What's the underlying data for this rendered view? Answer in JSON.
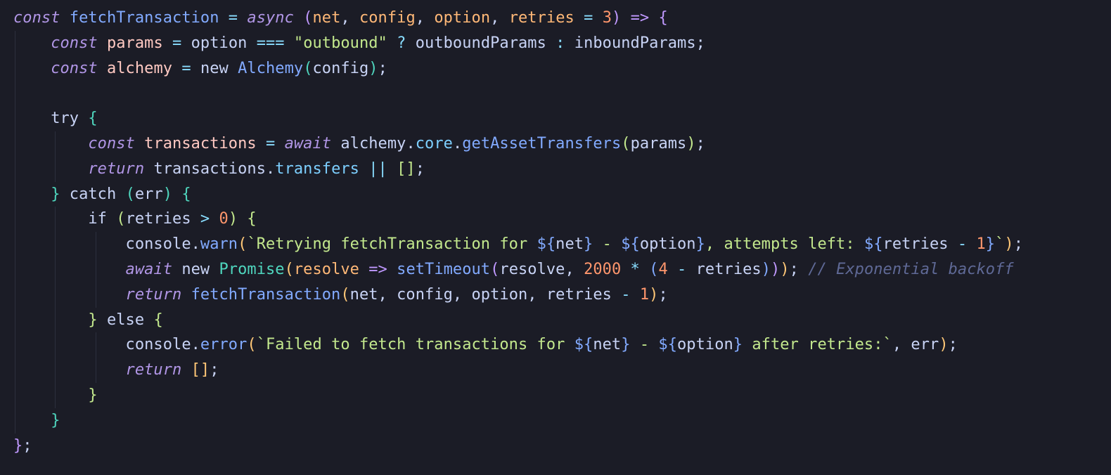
{
  "editor": {
    "language": "javascript",
    "background_color": "#1b1c26",
    "default_text_color": "#c8d3f5",
    "indent_guide_color": "#2c2f3d",
    "lines": [
      [
        {
          "t": "const",
          "c": "#b196e6",
          "i": true
        },
        {
          "t": " fetchTransaction",
          "c": "#82aaff"
        },
        {
          "t": " = ",
          "c": "#89ddff"
        },
        {
          "t": "async",
          "c": "#b196e6",
          "i": true
        },
        {
          "t": " (",
          "c": "#c099ff"
        },
        {
          "t": "net",
          "c": "#ffb877"
        },
        {
          "t": ", ",
          "c": "#c8d3f5"
        },
        {
          "t": "config",
          "c": "#ffb877"
        },
        {
          "t": ", ",
          "c": "#c8d3f5"
        },
        {
          "t": "option",
          "c": "#ffb877"
        },
        {
          "t": ", ",
          "c": "#c8d3f5"
        },
        {
          "t": "retries",
          "c": "#ffb877"
        },
        {
          "t": " = ",
          "c": "#89ddff"
        },
        {
          "t": "3",
          "c": "#ff966c"
        },
        {
          "t": ")",
          "c": "#c099ff"
        },
        {
          "t": " => ",
          "c": "#c099ff"
        },
        {
          "t": "{",
          "c": "#c099ff"
        }
      ],
      [
        {
          "t": "    ",
          "c": "#c8d3f5"
        },
        {
          "t": "const",
          "c": "#b196e6",
          "i": true
        },
        {
          "t": " params",
          "c": "#ffc9c2"
        },
        {
          "t": " = ",
          "c": "#89ddff"
        },
        {
          "t": "option",
          "c": "#c8d3f5"
        },
        {
          "t": " === ",
          "c": "#89ddff"
        },
        {
          "t": "\"outbound\"",
          "c": "#c3e88d"
        },
        {
          "t": " ? ",
          "c": "#89ddff"
        },
        {
          "t": "outboundParams",
          "c": "#c8d3f5"
        },
        {
          "t": " : ",
          "c": "#89ddff"
        },
        {
          "t": "inboundParams",
          "c": "#c8d3f5"
        },
        {
          "t": ";",
          "c": "#c8d3f5"
        }
      ],
      [
        {
          "t": "    ",
          "c": "#c8d3f5"
        },
        {
          "t": "const",
          "c": "#b196e6",
          "i": true
        },
        {
          "t": " alchemy",
          "c": "#ffc9c2"
        },
        {
          "t": " = ",
          "c": "#89ddff"
        },
        {
          "t": "new",
          "c": "#c8d3f5"
        },
        {
          "t": " Alchemy",
          "c": "#82aaff"
        },
        {
          "t": "(",
          "c": "#4fd6be"
        },
        {
          "t": "config",
          "c": "#c8d3f5"
        },
        {
          "t": ")",
          "c": "#4fd6be"
        },
        {
          "t": ";",
          "c": "#c8d3f5"
        }
      ],
      [],
      [
        {
          "t": "    ",
          "c": "#c8d3f5"
        },
        {
          "t": "try",
          "c": "#c8d3f5"
        },
        {
          "t": " {",
          "c": "#4fd6be"
        }
      ],
      [
        {
          "t": "        ",
          "c": "#c8d3f5"
        },
        {
          "t": "const",
          "c": "#b196e6",
          "i": true
        },
        {
          "t": " transactions",
          "c": "#ffc9c2"
        },
        {
          "t": " = ",
          "c": "#89ddff"
        },
        {
          "t": "await",
          "c": "#b196e6",
          "i": true
        },
        {
          "t": " alchemy",
          "c": "#c8d3f5"
        },
        {
          "t": ".",
          "c": "#c8d3f5"
        },
        {
          "t": "core",
          "c": "#7dcfff"
        },
        {
          "t": ".",
          "c": "#c8d3f5"
        },
        {
          "t": "getAssetTransfers",
          "c": "#82aaff"
        },
        {
          "t": "(",
          "c": "#c3e88d"
        },
        {
          "t": "params",
          "c": "#c8d3f5"
        },
        {
          "t": ")",
          "c": "#c3e88d"
        },
        {
          "t": ";",
          "c": "#c8d3f5"
        }
      ],
      [
        {
          "t": "        ",
          "c": "#c8d3f5"
        },
        {
          "t": "return",
          "c": "#b196e6",
          "i": true
        },
        {
          "t": " transactions",
          "c": "#c8d3f5"
        },
        {
          "t": ".",
          "c": "#c8d3f5"
        },
        {
          "t": "transfers",
          "c": "#7dcfff"
        },
        {
          "t": " || ",
          "c": "#89ddff"
        },
        {
          "t": "[]",
          "c": "#c3e88d"
        },
        {
          "t": ";",
          "c": "#c8d3f5"
        }
      ],
      [
        {
          "t": "    ",
          "c": "#c8d3f5"
        },
        {
          "t": "}",
          "c": "#4fd6be"
        },
        {
          "t": " catch ",
          "c": "#c8d3f5"
        },
        {
          "t": "(",
          "c": "#4fd6be"
        },
        {
          "t": "err",
          "c": "#c8d3f5"
        },
        {
          "t": ")",
          "c": "#4fd6be"
        },
        {
          "t": " {",
          "c": "#4fd6be"
        }
      ],
      [
        {
          "t": "        ",
          "c": "#c8d3f5"
        },
        {
          "t": "if",
          "c": "#c8d3f5"
        },
        {
          "t": " (",
          "c": "#c3e88d"
        },
        {
          "t": "retries",
          "c": "#c8d3f5"
        },
        {
          "t": " > ",
          "c": "#89ddff"
        },
        {
          "t": "0",
          "c": "#ff966c"
        },
        {
          "t": ")",
          "c": "#c3e88d"
        },
        {
          "t": " {",
          "c": "#c3e88d"
        }
      ],
      [
        {
          "t": "            ",
          "c": "#c8d3f5"
        },
        {
          "t": "console",
          "c": "#c8d3f5"
        },
        {
          "t": ".",
          "c": "#c8d3f5"
        },
        {
          "t": "warn",
          "c": "#82aaff"
        },
        {
          "t": "(",
          "c": "#ffc777"
        },
        {
          "t": "`Retrying fetchTransaction for ",
          "c": "#c3e88d"
        },
        {
          "t": "${",
          "c": "#82aaff"
        },
        {
          "t": "net",
          "c": "#c8d3f5"
        },
        {
          "t": "}",
          "c": "#82aaff"
        },
        {
          "t": " - ",
          "c": "#c3e88d"
        },
        {
          "t": "${",
          "c": "#82aaff"
        },
        {
          "t": "option",
          "c": "#c8d3f5"
        },
        {
          "t": "}",
          "c": "#82aaff"
        },
        {
          "t": ", attempts left: ",
          "c": "#c3e88d"
        },
        {
          "t": "${",
          "c": "#82aaff"
        },
        {
          "t": "retries",
          "c": "#c8d3f5"
        },
        {
          "t": " - ",
          "c": "#89ddff"
        },
        {
          "t": "1",
          "c": "#ff966c"
        },
        {
          "t": "}",
          "c": "#82aaff"
        },
        {
          "t": "`",
          "c": "#c3e88d"
        },
        {
          "t": ")",
          "c": "#ffc777"
        },
        {
          "t": ";",
          "c": "#c8d3f5"
        }
      ],
      [
        {
          "t": "            ",
          "c": "#c8d3f5"
        },
        {
          "t": "await",
          "c": "#b196e6",
          "i": true
        },
        {
          "t": " new",
          "c": "#c8d3f5"
        },
        {
          "t": " Promise",
          "c": "#4fd6be"
        },
        {
          "t": "(",
          "c": "#ffc777"
        },
        {
          "t": "resolve",
          "c": "#ffb877"
        },
        {
          "t": " => ",
          "c": "#c099ff"
        },
        {
          "t": "setTimeout",
          "c": "#82aaff"
        },
        {
          "t": "(",
          "c": "#c099ff"
        },
        {
          "t": "resolve",
          "c": "#c8d3f5"
        },
        {
          "t": ", ",
          "c": "#c8d3f5"
        },
        {
          "t": "2000",
          "c": "#ff966c"
        },
        {
          "t": " * ",
          "c": "#89ddff"
        },
        {
          "t": "(",
          "c": "#82aaff"
        },
        {
          "t": "4",
          "c": "#ff966c"
        },
        {
          "t": " - ",
          "c": "#89ddff"
        },
        {
          "t": "retries",
          "c": "#c8d3f5"
        },
        {
          "t": ")",
          "c": "#82aaff"
        },
        {
          "t": ")",
          "c": "#c099ff"
        },
        {
          "t": ")",
          "c": "#ffc777"
        },
        {
          "t": ";",
          "c": "#c8d3f5"
        },
        {
          "t": " // Exponential backoff",
          "c": "#5f6996",
          "i": true
        }
      ],
      [
        {
          "t": "            ",
          "c": "#c8d3f5"
        },
        {
          "t": "return",
          "c": "#b196e6",
          "i": true
        },
        {
          "t": " fetchTransaction",
          "c": "#82aaff"
        },
        {
          "t": "(",
          "c": "#ffc777"
        },
        {
          "t": "net",
          "c": "#c8d3f5"
        },
        {
          "t": ", ",
          "c": "#c8d3f5"
        },
        {
          "t": "config",
          "c": "#c8d3f5"
        },
        {
          "t": ", ",
          "c": "#c8d3f5"
        },
        {
          "t": "option",
          "c": "#c8d3f5"
        },
        {
          "t": ", ",
          "c": "#c8d3f5"
        },
        {
          "t": "retries",
          "c": "#c8d3f5"
        },
        {
          "t": " - ",
          "c": "#89ddff"
        },
        {
          "t": "1",
          "c": "#ff966c"
        },
        {
          "t": ")",
          "c": "#ffc777"
        },
        {
          "t": ";",
          "c": "#c8d3f5"
        }
      ],
      [
        {
          "t": "        ",
          "c": "#c8d3f5"
        },
        {
          "t": "}",
          "c": "#c3e88d"
        },
        {
          "t": " else",
          "c": "#c8d3f5"
        },
        {
          "t": " {",
          "c": "#c3e88d"
        }
      ],
      [
        {
          "t": "            ",
          "c": "#c8d3f5"
        },
        {
          "t": "console",
          "c": "#c8d3f5"
        },
        {
          "t": ".",
          "c": "#c8d3f5"
        },
        {
          "t": "error",
          "c": "#82aaff"
        },
        {
          "t": "(",
          "c": "#ffc777"
        },
        {
          "t": "`Failed to fetch transactions for ",
          "c": "#c3e88d"
        },
        {
          "t": "${",
          "c": "#82aaff"
        },
        {
          "t": "net",
          "c": "#c8d3f5"
        },
        {
          "t": "}",
          "c": "#82aaff"
        },
        {
          "t": " - ",
          "c": "#c3e88d"
        },
        {
          "t": "${",
          "c": "#82aaff"
        },
        {
          "t": "option",
          "c": "#c8d3f5"
        },
        {
          "t": "}",
          "c": "#82aaff"
        },
        {
          "t": " after retries:`",
          "c": "#c3e88d"
        },
        {
          "t": ", ",
          "c": "#c8d3f5"
        },
        {
          "t": "err",
          "c": "#c8d3f5"
        },
        {
          "t": ")",
          "c": "#ffc777"
        },
        {
          "t": ";",
          "c": "#c8d3f5"
        }
      ],
      [
        {
          "t": "            ",
          "c": "#c8d3f5"
        },
        {
          "t": "return",
          "c": "#b196e6",
          "i": true
        },
        {
          "t": " []",
          "c": "#ffc777"
        },
        {
          "t": ";",
          "c": "#c8d3f5"
        }
      ],
      [
        {
          "t": "        ",
          "c": "#c8d3f5"
        },
        {
          "t": "}",
          "c": "#c3e88d"
        }
      ],
      [
        {
          "t": "    ",
          "c": "#c8d3f5"
        },
        {
          "t": "}",
          "c": "#4fd6be"
        }
      ],
      [
        {
          "t": "}",
          "c": "#c099ff"
        },
        {
          "t": ";",
          "c": "#c8d3f5"
        }
      ]
    ]
  }
}
